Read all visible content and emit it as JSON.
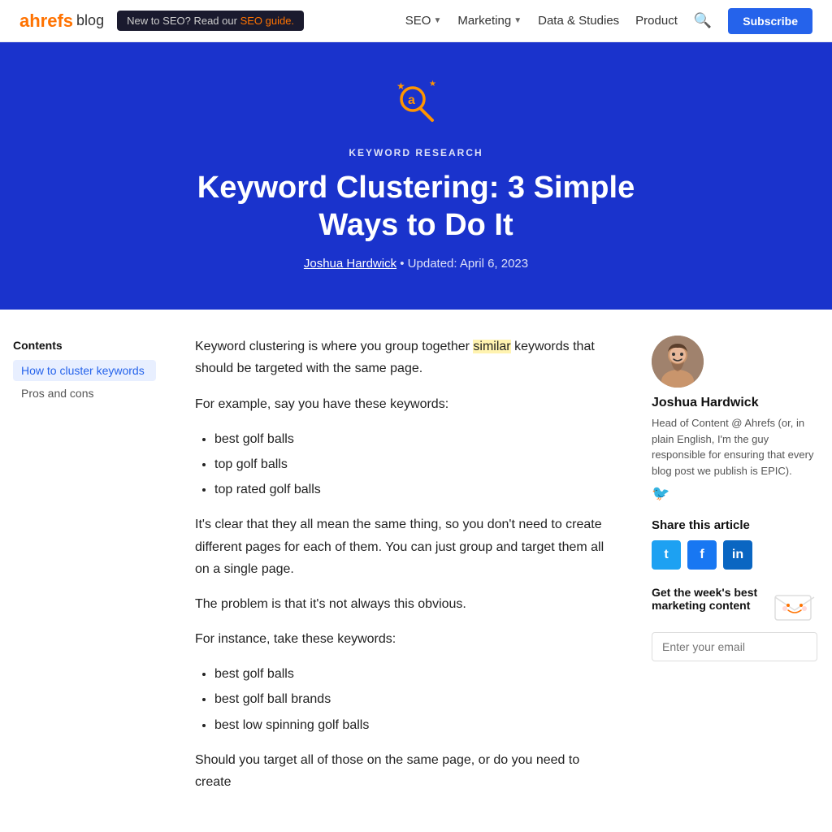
{
  "nav": {
    "logo": "ahrefs",
    "logo_blog": "blog",
    "banner_text": "New to SEO? Read our",
    "banner_link": "SEO guide.",
    "links": [
      {
        "label": "SEO",
        "has_dropdown": true
      },
      {
        "label": "Marketing",
        "has_dropdown": true
      },
      {
        "label": "Data & Studies",
        "has_dropdown": false
      },
      {
        "label": "Product",
        "has_dropdown": false
      }
    ],
    "subscribe_label": "Subscribe"
  },
  "hero": {
    "category": "KEYWORD RESEARCH",
    "title": "Keyword Clustering: 3 Simple Ways to Do It",
    "author": "Joshua Hardwick",
    "updated": "Updated: April 6, 2023"
  },
  "sidebar": {
    "title": "Contents",
    "items": [
      {
        "label": "How to cluster keywords",
        "active": true
      },
      {
        "label": "Pros and cons",
        "active": false
      }
    ]
  },
  "article": {
    "intro": "Keyword clustering is where you group together similar keywords that should be targeted with the same page.",
    "example_intro": "For example, say you have these keywords:",
    "keywords_list_1": [
      "best golf balls",
      "top golf balls",
      "top rated golf balls"
    ],
    "para2": "It's clear that they all mean the same thing, so you don't need to create different pages for each of them. You can just group and target them all on a single page.",
    "para3": "The problem is that it's not always this obvious.",
    "example_intro2": "For instance, take these keywords:",
    "keywords_list_2": [
      "best golf balls",
      "best golf ball brands",
      "best low spinning golf balls"
    ],
    "para4": "Should you target all of those on the same page, or do you need to create"
  },
  "author": {
    "name": "Joshua Hardwick",
    "bio": "Head of Content @ Ahrefs (or, in plain English, I'm the guy responsible for ensuring that every blog post we publish is EPIC)."
  },
  "share": {
    "title": "Share this article",
    "twitter_label": "t",
    "facebook_label": "f",
    "linkedin_label": "in"
  },
  "newsletter": {
    "title": "Get the week's best marketing content",
    "placeholder": "Enter your email"
  }
}
